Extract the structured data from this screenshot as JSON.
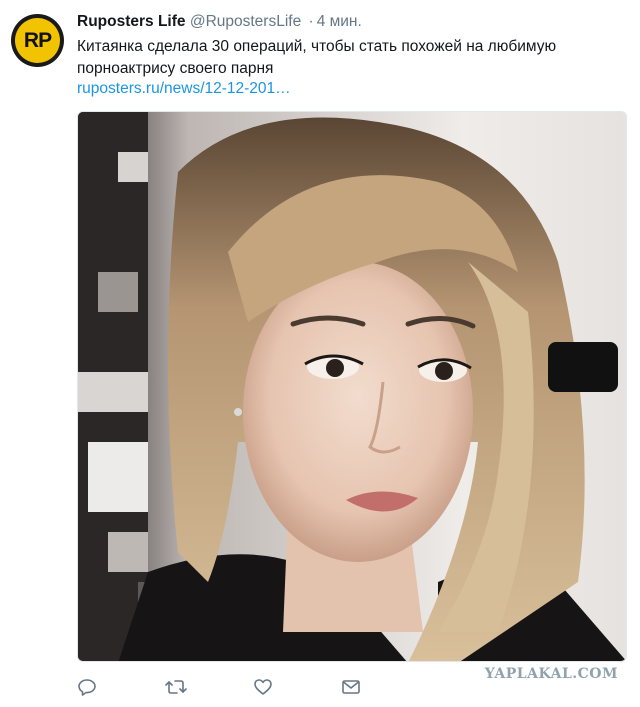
{
  "tweet": {
    "avatar_text": "RP",
    "author_name": "Ruposters Life",
    "author_handle": "@RupostersLife",
    "separator": "·",
    "time": "4 мин.",
    "text": "Китаянка сделала 30 операций, чтобы стать похожей на любимую порноактрису своего парня",
    "link_text": "ruposters.ru/news/12-12-201…"
  },
  "actions": {
    "icons": [
      "reply-icon",
      "retweet-icon",
      "like-icon",
      "direct-message-icon"
    ]
  },
  "watermark": "YAPLAKAL.COM",
  "colors": {
    "name": "#14171a",
    "secondary": "#657786",
    "link": "#1b95e0",
    "avatar_bg": "#f2c300"
  }
}
